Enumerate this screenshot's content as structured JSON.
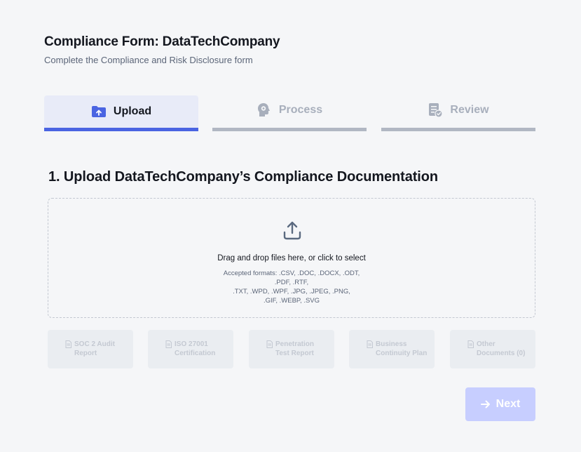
{
  "header": {
    "title": "Compliance Form: DataTechCompany",
    "subtitle": "Complete the Compliance and Risk Disclosure form"
  },
  "steps": [
    {
      "label": "Upload",
      "icon": "folder-upload-icon",
      "active": true
    },
    {
      "label": "Process",
      "icon": "head-gear-icon",
      "active": false
    },
    {
      "label": "Review",
      "icon": "document-check-icon",
      "active": false
    }
  ],
  "section": {
    "title": "1. Upload DataTechCompany’s Compliance Documentation"
  },
  "dropzone": {
    "icon": "upload-icon",
    "main_text": "Drag and drop files here, or click to select",
    "formats_lines": [
      "Accepted formats: .CSV, .DOC, .DOCX, .ODT,",
      ".PDF, .RTF,",
      ".TXT, .WPD, .WPF, .JPG, .JPEG, .PNG,",
      ".GIF, .WEBP, .SVG"
    ]
  },
  "doc_types": [
    {
      "line1": "SOC 2 Audit",
      "line2": "Report",
      "icon": "document-icon"
    },
    {
      "line1": "ISO 27001",
      "line2": "Certification",
      "icon": "document-icon"
    },
    {
      "line1": "Penetration",
      "line2": "Test Report",
      "icon": "document-icon"
    },
    {
      "line1": "Business",
      "line2": "Continuity Plan",
      "icon": "document-icon"
    },
    {
      "line1": "Other",
      "line2": "Documents (0)",
      "icon": "document-icon"
    }
  ],
  "next_button": {
    "label": "Next",
    "icon": "arrow-right-icon",
    "enabled": false
  },
  "colors": {
    "accent": "#4a64e2",
    "active_tab_bg": "#e8ebf8",
    "inactive_bar": "#b1b7c3",
    "next_disabled": "#c7ceff"
  }
}
